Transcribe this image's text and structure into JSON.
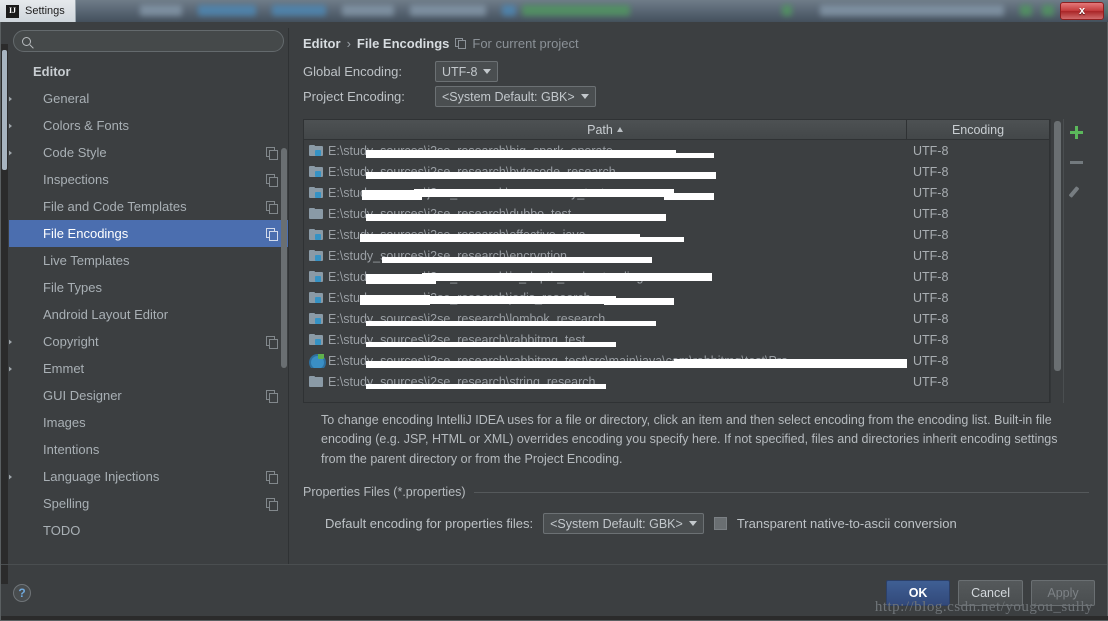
{
  "window": {
    "title": "Settings",
    "logo_text": "IJ",
    "close_label": "x"
  },
  "sidebar": {
    "search": {
      "value": "",
      "placeholder": ""
    },
    "items": [
      {
        "label": "Editor",
        "level": 0,
        "arrow": false,
        "copy": false,
        "selected": false,
        "root": true
      },
      {
        "label": "General",
        "level": 1,
        "arrow": true,
        "copy": false,
        "selected": false
      },
      {
        "label": "Colors & Fonts",
        "level": 1,
        "arrow": true,
        "copy": false,
        "selected": false
      },
      {
        "label": "Code Style",
        "level": 1,
        "arrow": true,
        "copy": true,
        "selected": false
      },
      {
        "label": "Inspections",
        "level": 1,
        "arrow": false,
        "copy": true,
        "selected": false
      },
      {
        "label": "File and Code Templates",
        "level": 1,
        "arrow": false,
        "copy": true,
        "selected": false
      },
      {
        "label": "File Encodings",
        "level": 1,
        "arrow": false,
        "copy": true,
        "selected": true
      },
      {
        "label": "Live Templates",
        "level": 1,
        "arrow": false,
        "copy": false,
        "selected": false
      },
      {
        "label": "File Types",
        "level": 1,
        "arrow": false,
        "copy": false,
        "selected": false
      },
      {
        "label": "Android Layout Editor",
        "level": 1,
        "arrow": false,
        "copy": false,
        "selected": false
      },
      {
        "label": "Copyright",
        "level": 1,
        "arrow": true,
        "copy": true,
        "selected": false
      },
      {
        "label": "Emmet",
        "level": 1,
        "arrow": true,
        "copy": false,
        "selected": false
      },
      {
        "label": "GUI Designer",
        "level": 1,
        "arrow": false,
        "copy": true,
        "selected": false
      },
      {
        "label": "Images",
        "level": 1,
        "arrow": false,
        "copy": false,
        "selected": false
      },
      {
        "label": "Intentions",
        "level": 1,
        "arrow": false,
        "copy": false,
        "selected": false
      },
      {
        "label": "Language Injections",
        "level": 1,
        "arrow": true,
        "copy": true,
        "selected": false
      },
      {
        "label": "Spelling",
        "level": 1,
        "arrow": false,
        "copy": true,
        "selected": false
      },
      {
        "label": "TODO",
        "level": 1,
        "arrow": false,
        "copy": false,
        "selected": false
      }
    ]
  },
  "main": {
    "breadcrumb": {
      "parent": "Editor",
      "separator": "›",
      "current": "File Encodings",
      "note": "For current project"
    },
    "global_encoding": {
      "label": "Global Encoding:",
      "value": "UTF-8"
    },
    "project_encoding": {
      "label": "Project Encoding:",
      "value": "<System Default: GBK>"
    },
    "table": {
      "columns": [
        "Path",
        "Encoding"
      ],
      "sort_column": "Path",
      "sort_direction": "asc",
      "rows": [
        {
          "icon": "source-folder-icon",
          "path": "E:\\study_sources\\j2se_research\\big_spark_operate",
          "encoding": "UTF-8"
        },
        {
          "icon": "source-folder-icon",
          "path": "E:\\study_sources\\j2se_research\\bytecode_research",
          "encoding": "UTF-8"
        },
        {
          "icon": "source-folder-icon",
          "path": "E:\\study_sources\\j2se_research\\concurrency_test",
          "encoding": "UTF-8"
        },
        {
          "icon": "folder-icon",
          "path": "E:\\study_sources\\j2se_research\\dubbo_test",
          "encoding": "UTF-8"
        },
        {
          "icon": "source-folder-icon",
          "path": "E:\\study_sources\\j2se_research\\effective_java",
          "encoding": "UTF-8"
        },
        {
          "icon": "source-folder-icon",
          "path": "E:\\study_sources\\j2se_research\\encryption",
          "encoding": "UTF-8"
        },
        {
          "icon": "source-folder-icon",
          "path": "E:\\study_sources\\j2se_research\\in_depth_understanding",
          "encoding": "UTF-8"
        },
        {
          "icon": "source-folder-icon",
          "path": "E:\\study_sources\\j2se_research\\jodis_research",
          "encoding": "UTF-8"
        },
        {
          "icon": "source-folder-icon",
          "path": "E:\\study_sources\\j2se_research\\lombok_research",
          "encoding": "UTF-8"
        },
        {
          "icon": "source-folder-icon",
          "path": "E:\\study_sources\\j2se_research\\rabbitmq_test",
          "encoding": "UTF-8"
        },
        {
          "icon": "java-class-icon",
          "path": "E:\\study_sources\\j2se_research\\rabbitmq_test\\src\\main\\java\\com\\rabbitmq\\test\\Pro",
          "encoding": "UTF-8"
        },
        {
          "icon": "folder-icon",
          "path": "E:\\study_sources\\j2se_research\\string_research",
          "encoding": "UTF-8"
        }
      ],
      "tools": {
        "add": "+",
        "remove": "-",
        "edit": "pencil"
      }
    },
    "description": "To change encoding IntelliJ IDEA uses for a file or directory, click an item and then select encoding from the encoding list. Built-in file encoding (e.g. JSP, HTML or XML) overrides encoding you specify here. If not specified, files and directories inherit encoding settings from the parent directory or from the Project Encoding.",
    "properties": {
      "legend": "Properties Files (*.properties)",
      "default_encoding_label": "Default encoding for properties files:",
      "default_encoding_value": "<System Default: GBK>",
      "transparent_checkbox_label": "Transparent native-to-ascii conversion",
      "transparent_checked": false
    }
  },
  "footer": {
    "help": "?",
    "ok": "OK",
    "cancel": "Cancel",
    "apply": "Apply",
    "watermark": "http://blog.csdn.net/yougou_sully"
  },
  "colors": {
    "accent_selection": "#4b6eaf",
    "panel_bg": "#3c3f41",
    "add_green": "#5bb85b",
    "close_red": "#c43c3d",
    "primary_button": "#3f5f94"
  }
}
